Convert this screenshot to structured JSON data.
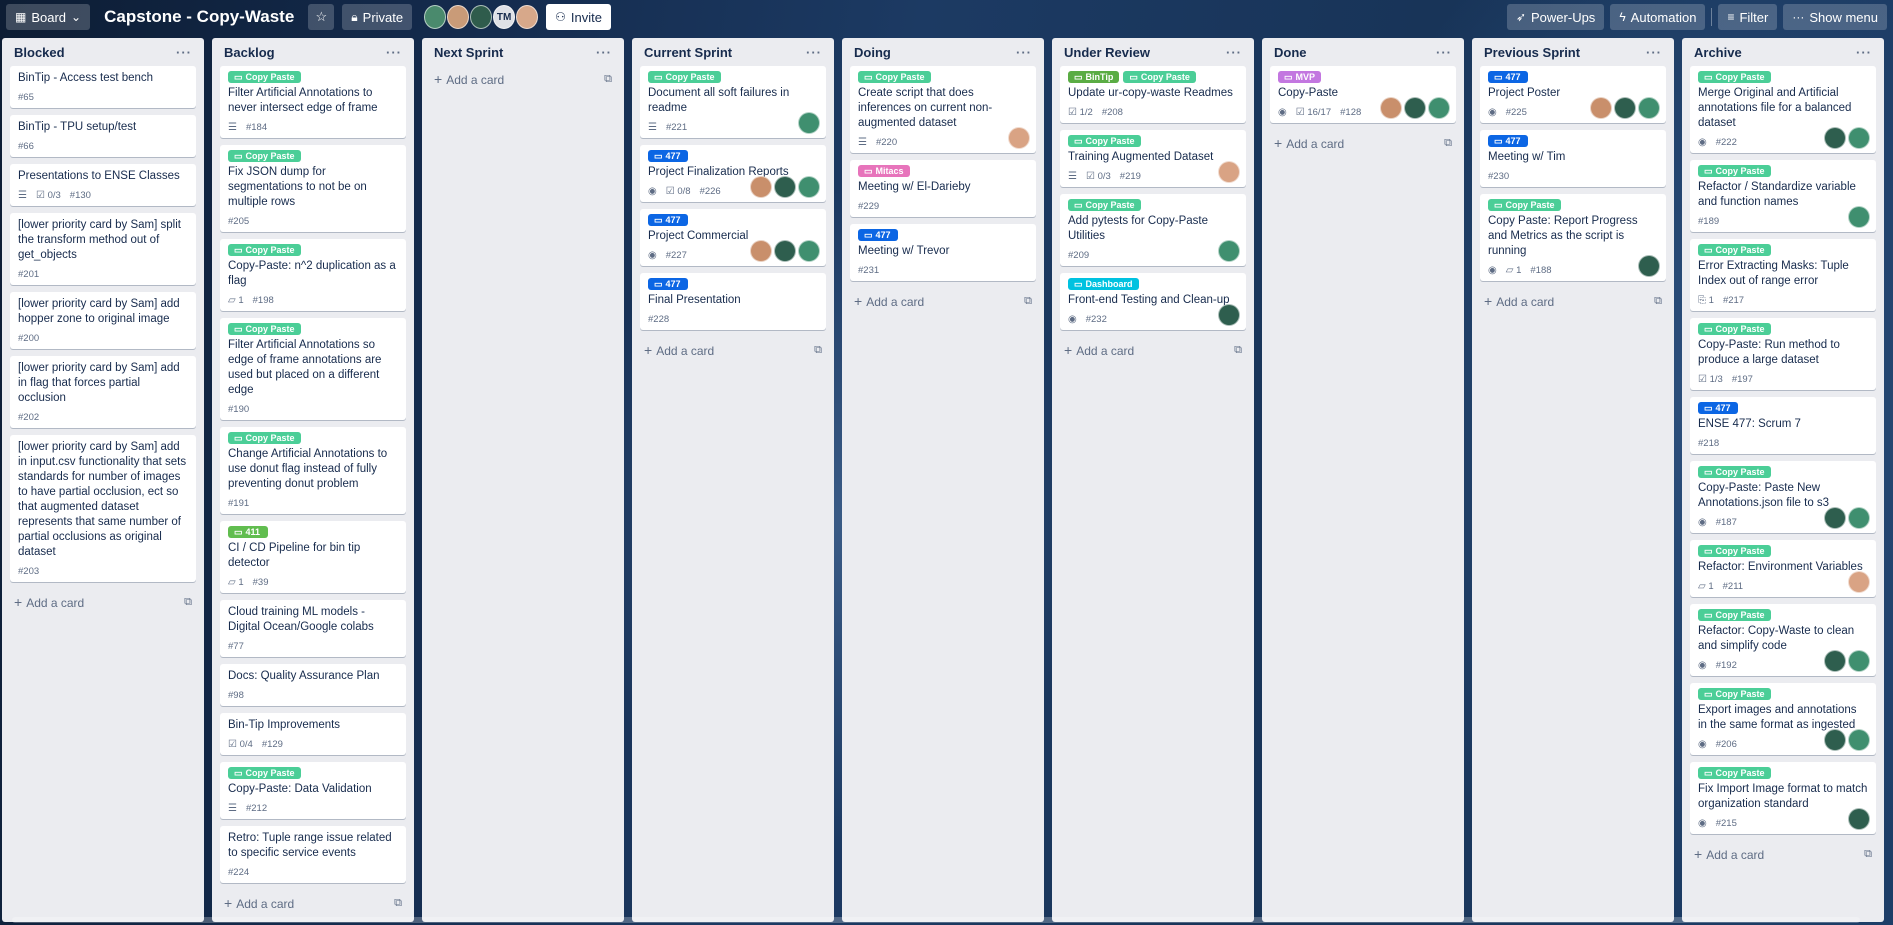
{
  "topbar": {
    "view_label": "Board",
    "board_title": "Capstone - Copy-Waste",
    "visibility_label": "Private",
    "member_initials": "TM",
    "invite_label": "Invite",
    "powerups_label": "Power-Ups",
    "automation_label": "Automation",
    "filter_label": "Filter",
    "show_menu_label": "Show menu"
  },
  "add_card_label": "Add a card",
  "label_colors": {
    "Copy Paste": "#4bce97",
    "477": "#0c66e4",
    "Mitacs": "#e774bb",
    "BinTip": "#5aac44",
    "MVP": "#c377e0",
    "Dashboard": "#00c2e0",
    "411": "#61bd4f"
  },
  "avatar_colors": [
    "#c98f6b",
    "#2e5e4e",
    "#3f8f6f",
    "#d9a384"
  ],
  "lists": [
    {
      "title": "Blocked",
      "cards": [
        {
          "title": "BinTip - Access test bench",
          "number": "#65"
        },
        {
          "title": "BinTip - TPU setup/test",
          "number": "#66"
        },
        {
          "title": "Presentations to ENSE Classes",
          "desc": true,
          "checklist": "0/3",
          "number": "#130"
        },
        {
          "title": "[lower priority card by Sam] split the transform method out of get_objects",
          "number": "#201"
        },
        {
          "title": "[lower priority card by Sam] add hopper zone to original image",
          "number": "#200"
        },
        {
          "title": "[lower priority card by Sam] add in flag that forces partial occlusion",
          "number": "#202"
        },
        {
          "title": "[lower priority card by Sam] add in input.csv functionality that sets standards for number of images to have partial occlusion, ect so that augmented dataset represents that same number of partial occlusions as original dataset",
          "number": "#203"
        }
      ]
    },
    {
      "title": "Backlog",
      "cards": [
        {
          "labels": [
            "Copy Paste"
          ],
          "title": "Filter Artificial Annotations to never intersect edge of frame",
          "desc": true,
          "number": "#184"
        },
        {
          "labels": [
            "Copy Paste"
          ],
          "title": "Fix JSON dump for segmentations to not be on multiple rows",
          "number": "#205"
        },
        {
          "labels": [
            "Copy Paste"
          ],
          "title": "Copy-Paste: n^2 duplication as a flag",
          "comments": "1",
          "number": "#198"
        },
        {
          "labels": [
            "Copy Paste"
          ],
          "title": "Filter Artificial Annotations so edge of frame annotations are used but placed on a different edge",
          "number": "#190"
        },
        {
          "labels": [
            "Copy Paste"
          ],
          "title": "Change Artificial Annotations to use donut flag instead of fully preventing donut problem",
          "number": "#191"
        },
        {
          "labels": [
            "411"
          ],
          "title": "CI / CD Pipeline for bin tip detector",
          "comments": "1",
          "number": "#39"
        },
        {
          "title": "Cloud training ML models - Digital Ocean/Google colabs",
          "number": "#77"
        },
        {
          "title": "Docs: Quality Assurance Plan",
          "number": "#98"
        },
        {
          "title": "Bin-Tip Improvements",
          "checklist": "0/4",
          "number": "#129"
        },
        {
          "labels": [
            "Copy Paste"
          ],
          "title": "Copy-Paste: Data Validation",
          "desc": true,
          "number": "#212"
        },
        {
          "title": "Retro: Tuple range issue related to specific service events",
          "number": "#224"
        }
      ]
    },
    {
      "title": "Next Sprint",
      "cards": []
    },
    {
      "title": "Current Sprint",
      "cards": [
        {
          "labels": [
            "Copy Paste"
          ],
          "title": "Document all soft failures in readme",
          "desc": true,
          "number": "#221",
          "avatars": [
            2
          ]
        },
        {
          "labels": [
            "477"
          ],
          "title": "Project Finalization Reports",
          "watch": true,
          "checklist": "0/8",
          "number": "#226",
          "avatars": [
            0,
            1,
            2
          ]
        },
        {
          "labels": [
            "477"
          ],
          "title": "Project Commercial",
          "watch": true,
          "number": "#227",
          "avatars": [
            0,
            1,
            2
          ]
        },
        {
          "labels": [
            "477"
          ],
          "title": "Final Presentation",
          "number": "#228"
        }
      ]
    },
    {
      "title": "Doing",
      "cards": [
        {
          "labels": [
            "Copy Paste"
          ],
          "title": "Create script that does inferences on current non-augmented dataset",
          "desc": true,
          "number": "#220",
          "avatars": [
            3
          ]
        },
        {
          "labels": [
            "Mitacs"
          ],
          "title": "Meeting w/ El-Darieby",
          "number": "#229"
        },
        {
          "labels": [
            "477"
          ],
          "title": "Meeting w/ Trevor",
          "number": "#231"
        }
      ]
    },
    {
      "title": "Under Review",
      "cards": [
        {
          "labels": [
            "BinTip",
            "Copy Paste"
          ],
          "title": "Update ur-copy-waste Readmes",
          "checklist": "1/2",
          "number": "#208"
        },
        {
          "labels": [
            "Copy Paste"
          ],
          "title": "Training Augmented Dataset",
          "desc": true,
          "checklist": "0/3",
          "number": "#219",
          "avatars": [
            3
          ]
        },
        {
          "labels": [
            "Copy Paste"
          ],
          "title": "Add pytests for Copy-Paste Utilities",
          "number": "#209",
          "avatars": [
            2
          ]
        },
        {
          "labels": [
            "Dashboard"
          ],
          "title": "Front-end Testing and Clean-up",
          "watch": true,
          "number": "#232",
          "avatars": [
            1
          ]
        }
      ]
    },
    {
      "title": "Done",
      "cards": [
        {
          "labels": [
            "MVP"
          ],
          "title": "Copy-Paste",
          "watch": true,
          "checklist": "16/17",
          "number": "#128",
          "avatars": [
            0,
            1,
            2
          ]
        }
      ]
    },
    {
      "title": "Previous Sprint",
      "cards": [
        {
          "labels": [
            "477"
          ],
          "title": "Project Poster",
          "watch": true,
          "number": "#225",
          "avatars": [
            0,
            1,
            2
          ]
        },
        {
          "labels": [
            "477"
          ],
          "title": "Meeting w/ Tim",
          "number": "#230"
        },
        {
          "labels": [
            "Copy Paste"
          ],
          "title": "Copy Paste: Report Progress and Metrics as the script is running",
          "watch": true,
          "comments": "1",
          "number": "#188",
          "avatars": [
            1
          ]
        }
      ]
    },
    {
      "title": "Archive",
      "cards": [
        {
          "labels": [
            "Copy Paste"
          ],
          "title": "Merge Original and Artificial annotations file for a balanced dataset",
          "watch": true,
          "number": "#222",
          "avatars": [
            1,
            2
          ]
        },
        {
          "labels": [
            "Copy Paste"
          ],
          "title": "Refactor / Standardize variable and function names",
          "number": "#189",
          "avatars": [
            2
          ]
        },
        {
          "labels": [
            "Copy Paste"
          ],
          "title": "Error Extracting Masks: Tuple Index out of range error",
          "attachments": "1",
          "number": "#217"
        },
        {
          "labels": [
            "Copy Paste"
          ],
          "title": "Copy-Paste: Run method to produce a large dataset",
          "checklist": "1/3",
          "number": "#197"
        },
        {
          "labels": [
            "477"
          ],
          "title": "ENSE 477: Scrum 7",
          "number": "#218"
        },
        {
          "labels": [
            "Copy Paste"
          ],
          "title": "Copy-Paste: Paste New Annotations.json file to s3",
          "watch": true,
          "number": "#187",
          "avatars": [
            1,
            2
          ]
        },
        {
          "labels": [
            "Copy Paste"
          ],
          "title": "Refactor: Environment Variables",
          "comments": "1",
          "number": "#211",
          "avatars": [
            3
          ]
        },
        {
          "labels": [
            "Copy Paste"
          ],
          "title": "Refactor: Copy-Waste to clean and simplify code",
          "watch": true,
          "number": "#192",
          "avatars": [
            1,
            2
          ]
        },
        {
          "labels": [
            "Copy Paste"
          ],
          "title": "Export images and annotations in the same format as ingested",
          "watch": true,
          "number": "#206",
          "avatars": [
            1,
            2
          ]
        },
        {
          "labels": [
            "Copy Paste"
          ],
          "title": "Fix Import Image format to match organization standard",
          "watch": true,
          "number": "#215",
          "avatars": [
            1
          ]
        }
      ]
    }
  ]
}
